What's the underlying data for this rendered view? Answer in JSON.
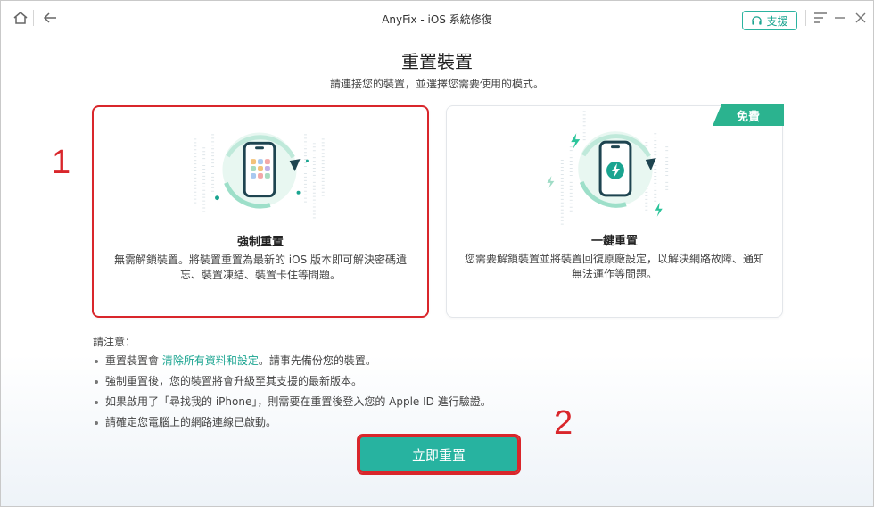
{
  "window": {
    "title": "AnyFix - iOS 系統修復",
    "support_label": "支援"
  },
  "header": {
    "title": "重置裝置",
    "subtitle": "請連接您的裝置，並選擇您需要使用的模式。"
  },
  "cards": [
    {
      "title": "強制重置",
      "description": "無需解鎖裝置。將裝置重置為最新的 iOS 版本即可解決密碼遺忘、裝置凍結、裝置卡住等問題。",
      "selected": true
    },
    {
      "title": "一鍵重置",
      "description": "您需要解鎖裝置並將裝置回復原廠設定，以解決網路故障、通知無法運作等問題。",
      "badge": "免費",
      "selected": false
    }
  ],
  "notes": {
    "title": "請注意：",
    "items": [
      {
        "before": "重置裝置會 ",
        "highlight": "清除所有資料和設定",
        "after": "。請事先備份您的裝置。"
      },
      {
        "before": "強制重置後，您的裝置將會升級至其支援的最新版本。",
        "highlight": "",
        "after": ""
      },
      {
        "before": "如果啟用了「尋找我的 iPhone」，則需要在重置後登入您的 Apple ID 進行驗證。",
        "highlight": "",
        "after": ""
      },
      {
        "before": "請確定您電腦上的網路連線已啟動。",
        "highlight": "",
        "after": ""
      }
    ]
  },
  "actions": {
    "primary_label": "立即重置"
  },
  "annotations": {
    "step1": "1",
    "step2": "2"
  },
  "colors": {
    "accent": "#27b3a0",
    "highlight_text": "#1aa490",
    "annotation_red": "#d9262b"
  }
}
